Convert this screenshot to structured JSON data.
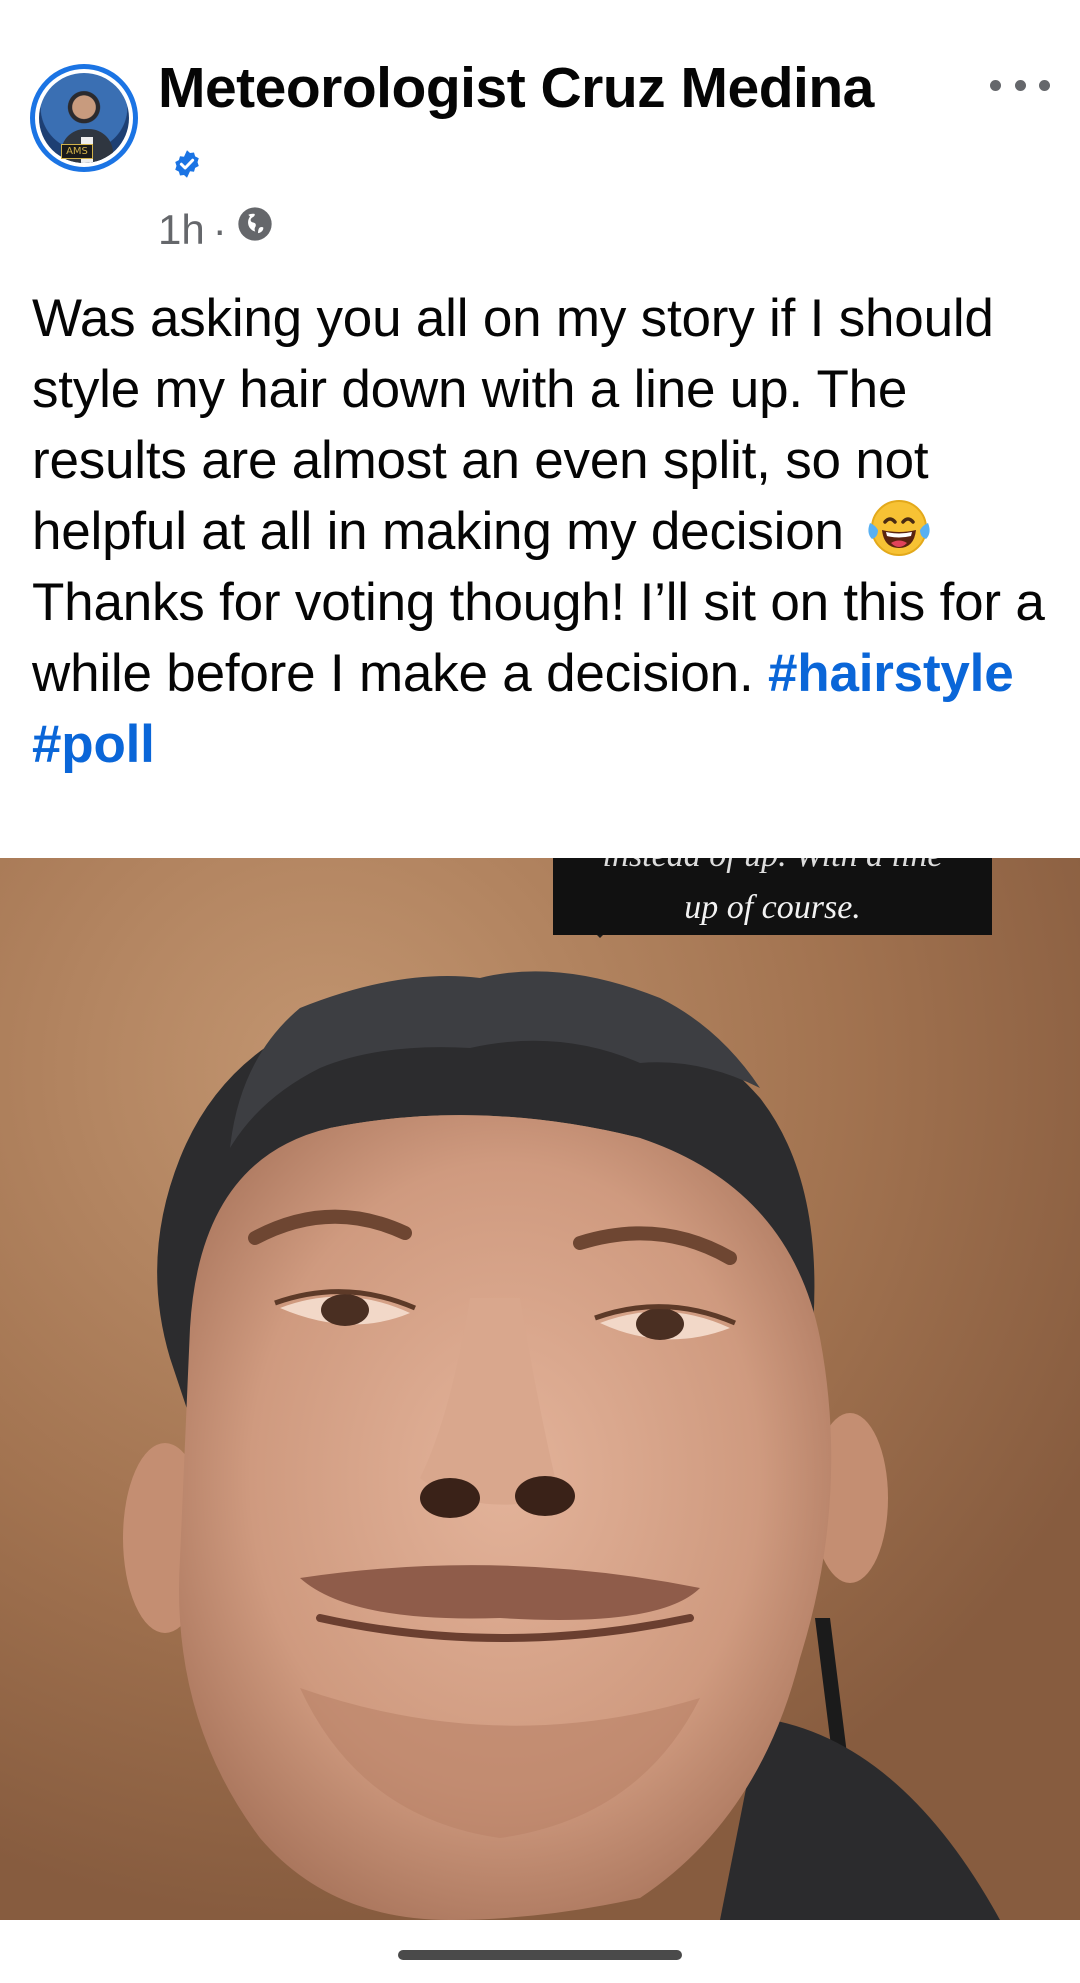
{
  "post": {
    "author": {
      "name": "Meteorologist Cruz Medina",
      "verified": true,
      "avatar_badge_text": "AMS"
    },
    "time": "1h",
    "separator": "·",
    "audience_icon": "globe-icon",
    "more_icon": "more-options-icon",
    "text_segments": [
      "Was asking you all on my story if I should style my hair down with a line up. The results are almost an even split, so not helpful at all in making my decision",
      "Thanks for voting though! I’ll sit on this for a while before I make a decision."
    ],
    "emoji": "face-with-tears-of-joy",
    "hashtags": [
      "#hairstyle",
      "#poll"
    ],
    "photo": {
      "overlay_caption_partial": "instead of up. With a line",
      "overlay_caption": "up of course."
    }
  },
  "colors": {
    "hashtag": "#0a66d8",
    "verified": "#1b74e4",
    "meta_text": "#65676b"
  }
}
